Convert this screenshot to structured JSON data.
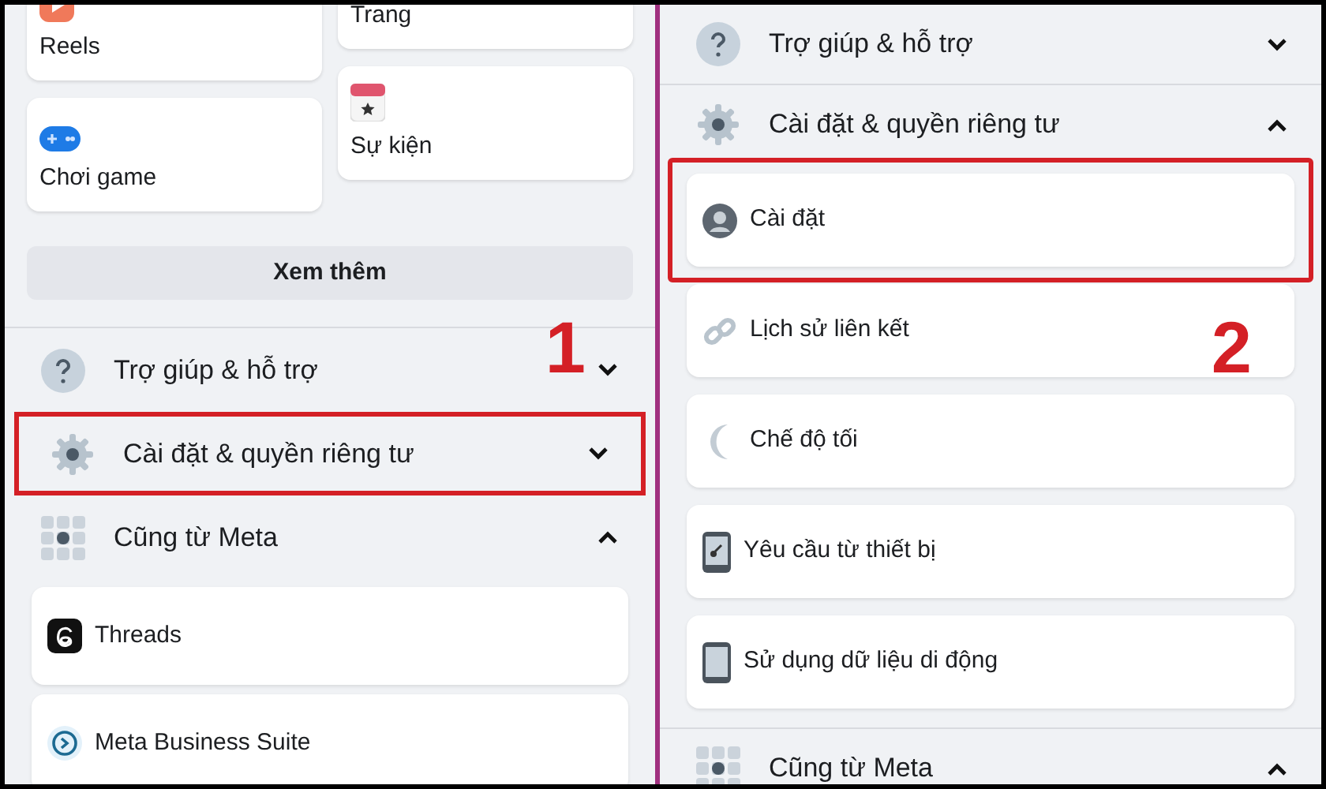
{
  "panels": [
    {
      "step": "1",
      "shortcuts": [
        [
          {
            "label": "Reels",
            "kind": "reels"
          },
          {
            "label": "Chơi game",
            "kind": "game"
          }
        ],
        [
          {
            "label": "Trang",
            "kind": "page"
          },
          {
            "label": "Sự kiện",
            "kind": "event"
          }
        ]
      ],
      "more_button": "Xem thêm",
      "sections": [
        {
          "label": "Trợ giúp & hỗ trợ",
          "kind": "help",
          "expanded": false,
          "highlighted": false
        },
        {
          "label": "Cài đặt & quyền riêng tư",
          "kind": "settings",
          "expanded": false,
          "highlighted": true
        },
        {
          "label": "Cũng từ Meta",
          "kind": "meta",
          "expanded": true,
          "highlighted": false,
          "items": [
            {
              "label": "Threads",
              "kind": "threads",
              "highlighted": false
            },
            {
              "label": "Meta Business Suite",
              "kind": "business",
              "highlighted": false
            }
          ]
        }
      ]
    },
    {
      "step": "2",
      "sections": [
        {
          "label": "Trợ giúp & hỗ trợ",
          "kind": "help",
          "expanded": false,
          "highlighted": false
        },
        {
          "label": "Cài đặt & quyền riêng tư",
          "kind": "settings",
          "expanded": true,
          "highlighted": false,
          "items": [
            {
              "label": "Cài đặt",
              "kind": "account",
              "highlighted": true
            },
            {
              "label": "Lịch sử liên kết",
              "kind": "link",
              "highlighted": false
            },
            {
              "label": "Chế độ tối",
              "kind": "moon",
              "highlighted": false
            },
            {
              "label": "Yêu cầu từ thiết bị",
              "kind": "device-key",
              "highlighted": false
            },
            {
              "label": "Sử dụng dữ liệu di động",
              "kind": "device",
              "highlighted": false
            }
          ]
        },
        {
          "label": "Cũng từ Meta",
          "kind": "meta",
          "expanded": true,
          "highlighted": false
        }
      ]
    }
  ]
}
